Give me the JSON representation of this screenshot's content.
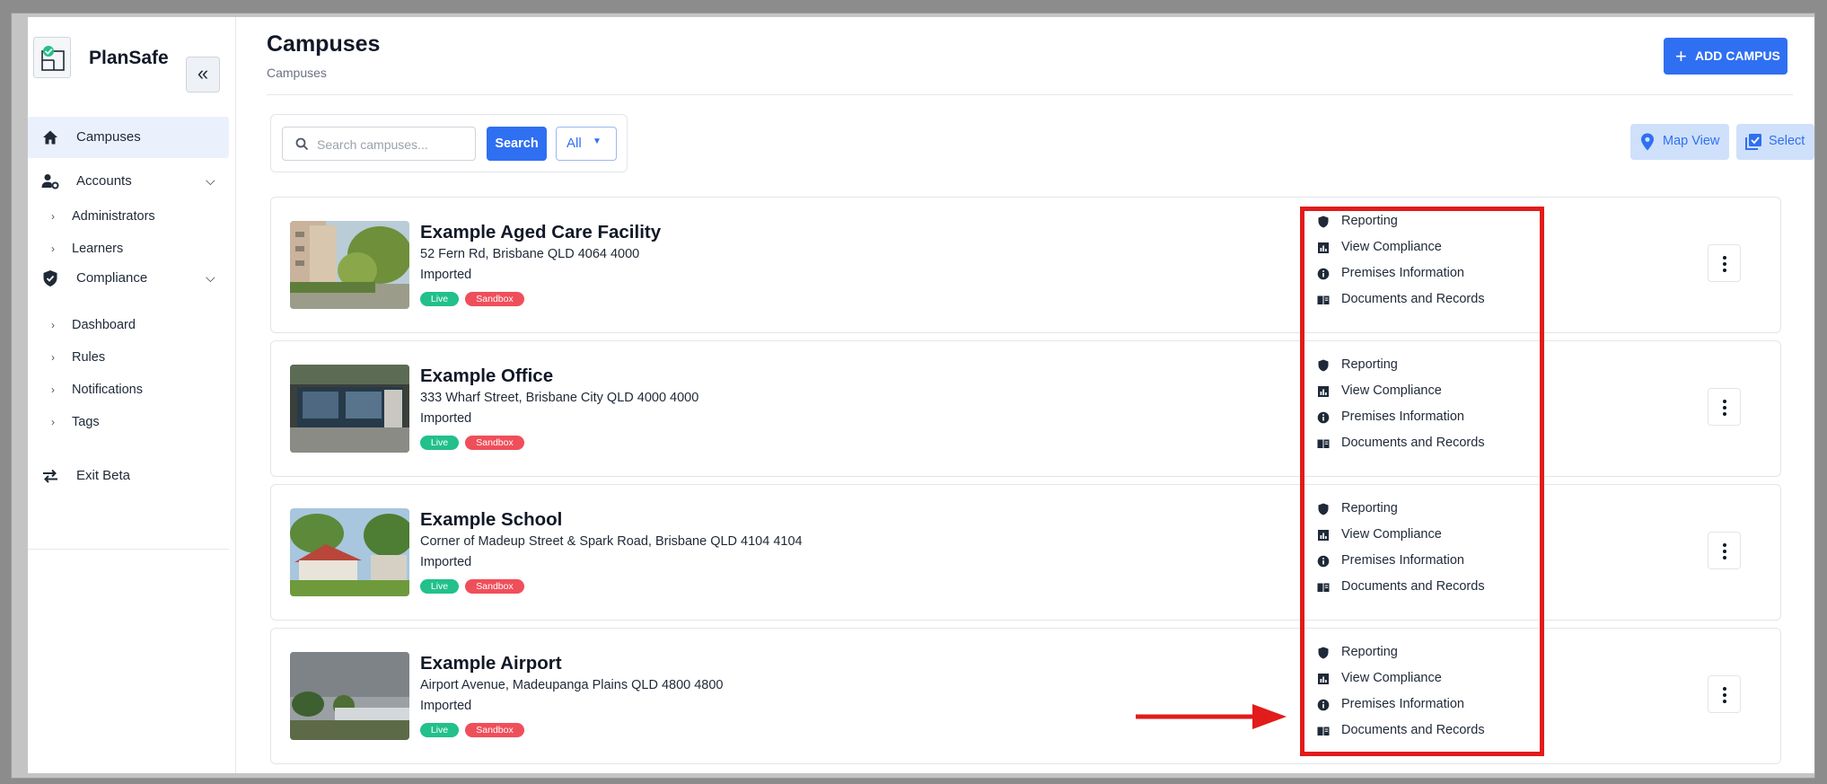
{
  "app": {
    "name": "PlanSafe",
    "collapse_label": "«"
  },
  "sidebar": {
    "items": [
      {
        "label": "Campuses",
        "icon": "home-icon",
        "active": true
      },
      {
        "label": "Accounts",
        "icon": "user-gear-icon",
        "expanded": true
      },
      {
        "label": "Compliance",
        "icon": "shield-check-icon",
        "expanded": true
      },
      {
        "label": "Exit Beta",
        "icon": "swap-arrows-icon"
      }
    ],
    "accounts_children": [
      "Administrators",
      "Learners"
    ],
    "compliance_children": [
      "Dashboard",
      "Rules",
      "Notifications",
      "Tags"
    ]
  },
  "header": {
    "title": "Campuses",
    "breadcrumb": "Campuses",
    "add_button": "ADD CAMPUS"
  },
  "toolbar": {
    "search_placeholder": "Search campuses...",
    "search_value": "",
    "search_button": "Search",
    "filter_value": "All",
    "map_view_button": "Map View",
    "select_button": "Select"
  },
  "campuses": [
    {
      "name": "Example Aged Care Facility",
      "address": "52 Fern Rd, Brisbane QLD 4064 4000",
      "status": "Imported",
      "badges": [
        "Live",
        "Sandbox"
      ]
    },
    {
      "name": "Example Office",
      "address": "333 Wharf Street, Brisbane City QLD 4000 4000",
      "status": "Imported",
      "badges": [
        "Live",
        "Sandbox"
      ]
    },
    {
      "name": "Example School",
      "address": "Corner of Madeup Street & Spark Road, Brisbane QLD 4104 4104",
      "status": "Imported",
      "badges": [
        "Live",
        "Sandbox"
      ]
    },
    {
      "name": "Example Airport",
      "address": "Airport Avenue, Madeupanga Plains QLD 4800 4800",
      "status": "Imported",
      "badges": [
        "Live",
        "Sandbox"
      ]
    }
  ],
  "card_actions": [
    {
      "label": "Reporting",
      "icon": "shield-icon"
    },
    {
      "label": "View Compliance",
      "icon": "chart-icon"
    },
    {
      "label": "Premises Information",
      "icon": "info-icon"
    },
    {
      "label": "Documents and Records",
      "icon": "book-icon"
    }
  ],
  "colors": {
    "primary": "#2f6ff1",
    "live_badge": "#22c08a",
    "sandbox_badge": "#ef4f5a",
    "annotation": "#e21b1b"
  }
}
